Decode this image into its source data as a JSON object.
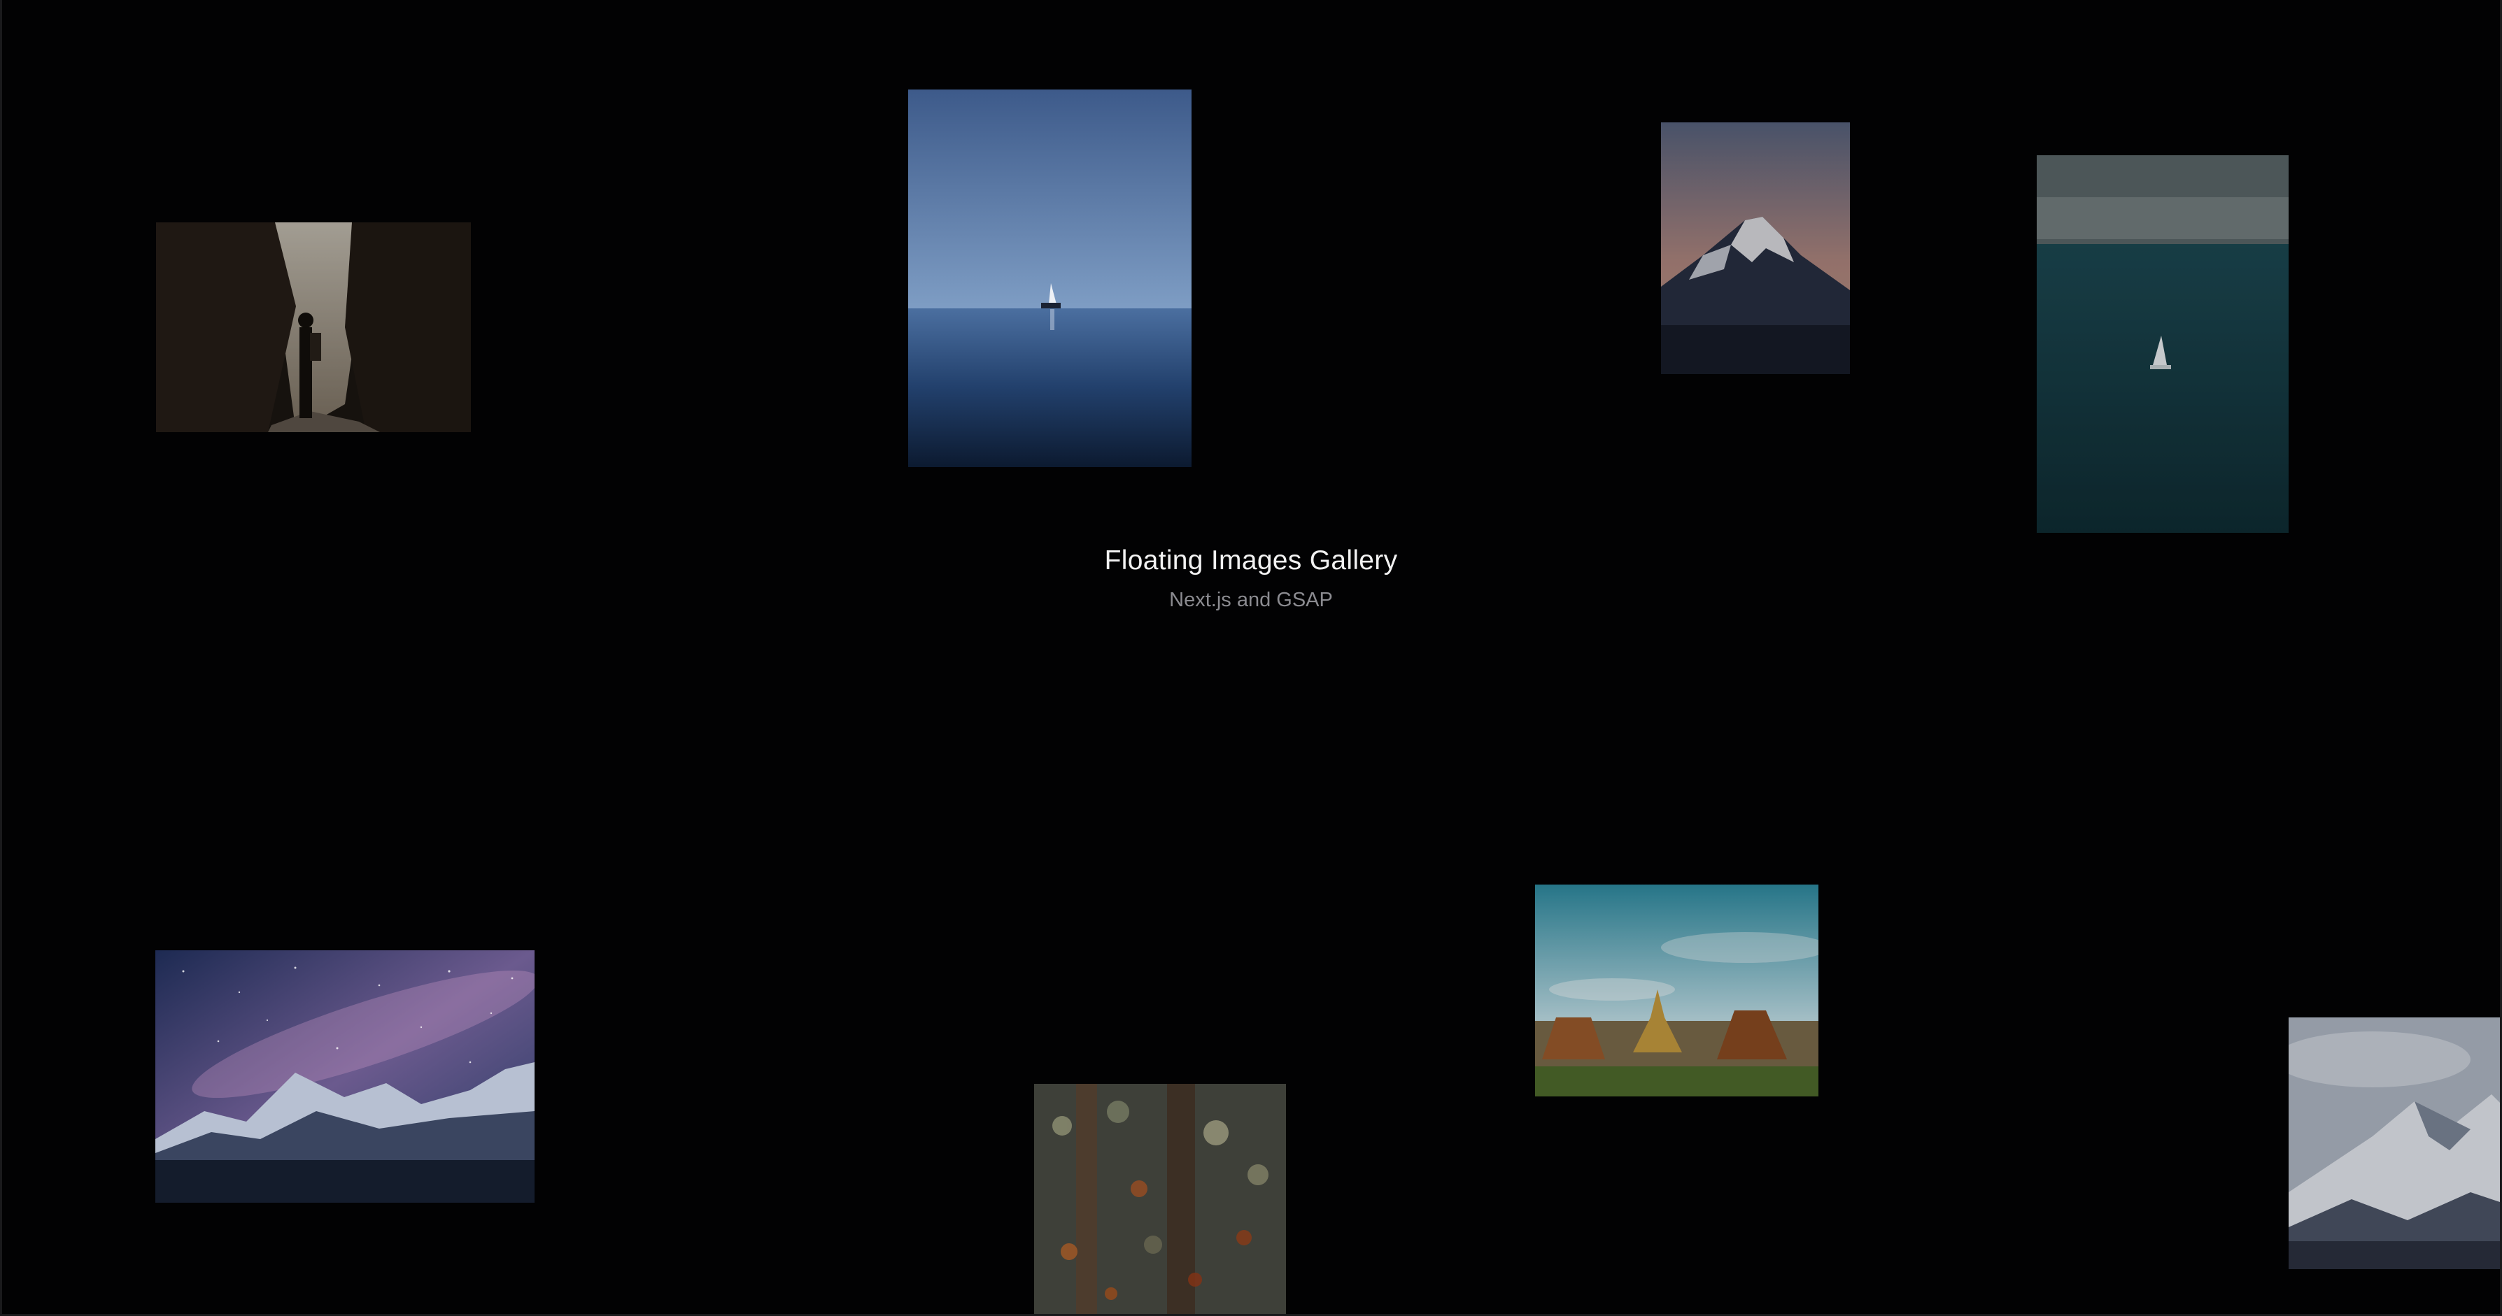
{
  "gallery": {
    "title": "Floating Images Gallery",
    "subtitle": "Next.js and GSAP"
  },
  "colors": {
    "background": "#020203",
    "title": "#f2f2f2",
    "subtitle": "#8b8b90"
  }
}
